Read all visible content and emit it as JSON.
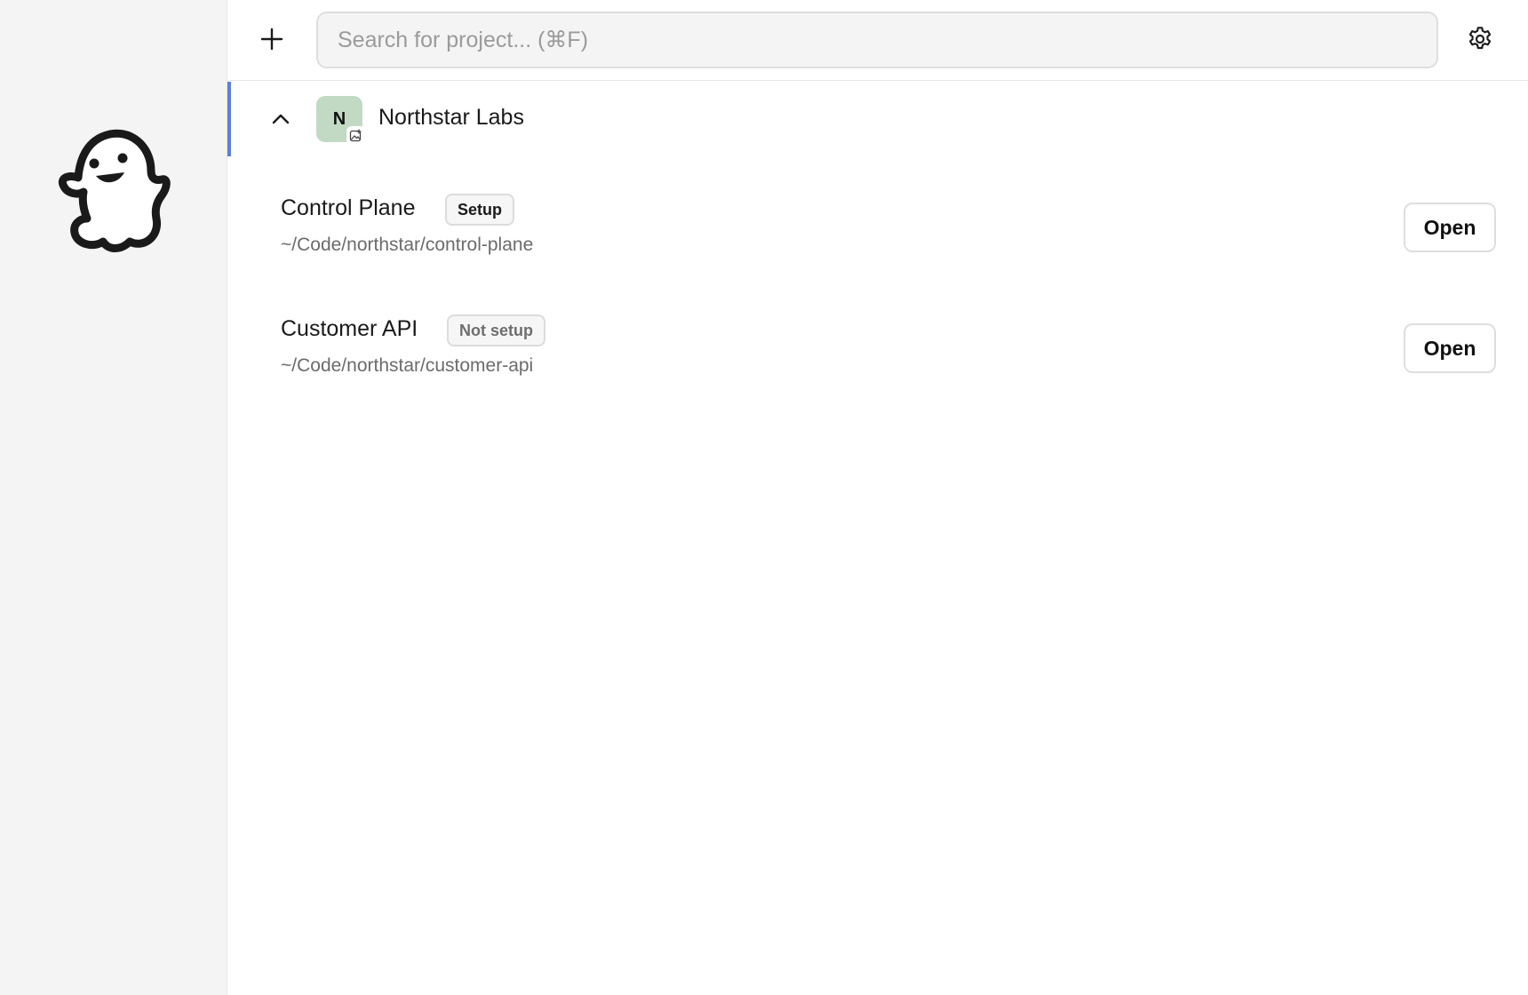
{
  "topbar": {
    "add_icon": "plus-icon",
    "search_placeholder": "Search for project... (⌘F)",
    "search_value": "",
    "settings_icon": "gear-icon"
  },
  "sidebar": {
    "logo_icon": "ghost-icon"
  },
  "group": {
    "name": "Northstar Labs",
    "avatar_letter": "N",
    "avatar_color": "#c2dac4",
    "accent_color": "#5b7fe0",
    "expanded": true,
    "projects": [
      {
        "name": "Control Plane",
        "status": "Setup",
        "status_color": "#1a1a1a",
        "path": "~/Code/northstar/control-plane",
        "action_label": "Open"
      },
      {
        "name": "Customer API",
        "status": "Not setup",
        "status_color": "#6e6e6e",
        "path": "~/Code/northstar/customer-api",
        "action_label": "Open"
      }
    ]
  }
}
